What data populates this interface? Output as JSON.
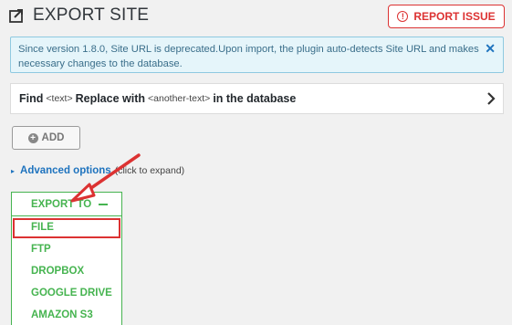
{
  "header": {
    "title": "EXPORT SITE",
    "report_button": "REPORT ISSUE"
  },
  "notice": {
    "text": "Since version 1.8.0, Site URL is deprecated.Upon import, the plugin auto-detects Site URL and makes necessary changes to the database.",
    "close": "✕"
  },
  "find_replace": {
    "find": "Find",
    "text_token": "<text>",
    "replace": "Replace with",
    "another_token": "<another-text>",
    "suffix": "in the database"
  },
  "add_button": "ADD",
  "advanced": {
    "link": "Advanced options",
    "hint": "(click to expand)"
  },
  "export_to": {
    "label": "EXPORT TO",
    "items": [
      "FILE",
      "FTP",
      "DROPBOX",
      "GOOGLE DRIVE",
      "AMAZON S3"
    ],
    "selected": "FILE"
  },
  "colors": {
    "accent_red": "#dc3232",
    "accent_green": "#46b450",
    "link_blue": "#1e73be"
  }
}
